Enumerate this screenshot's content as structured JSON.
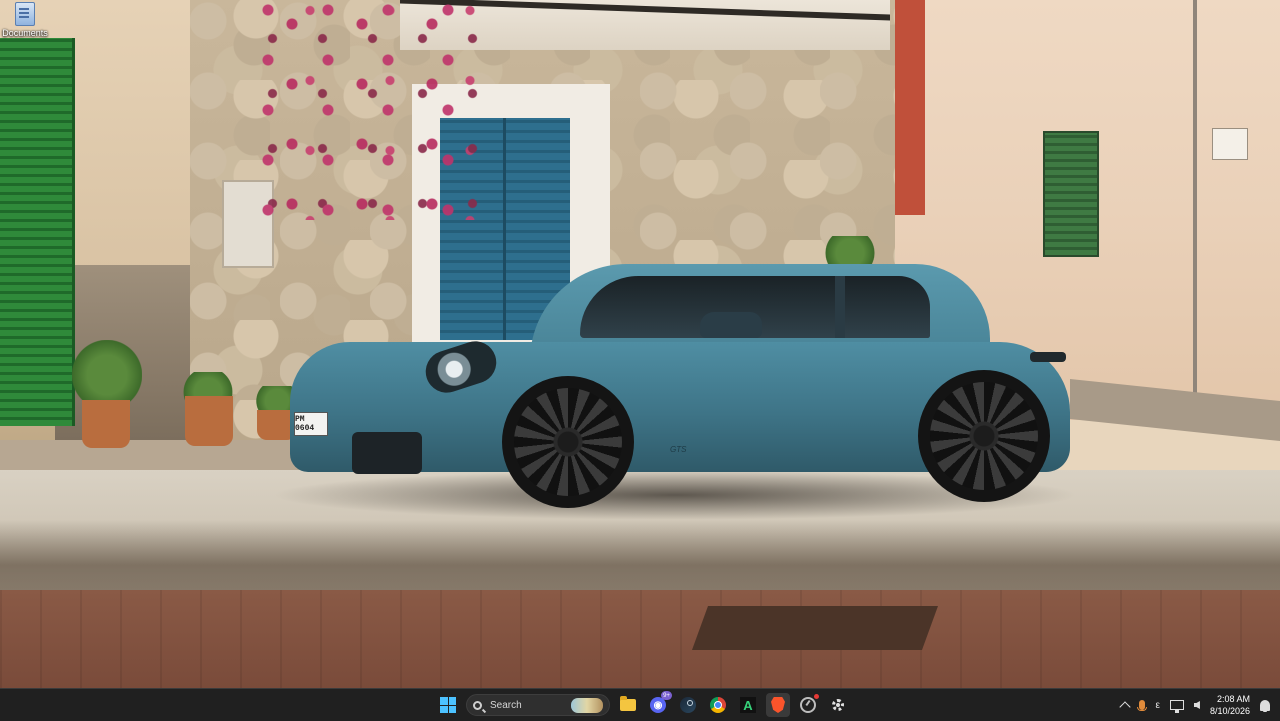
{
  "desktop": {
    "icons": [
      {
        "label": "Documents",
        "icon": "documents-icon"
      }
    ],
    "wallpaper": {
      "car_plate": "PM 0604",
      "car_badge": "GTS"
    }
  },
  "taskbar": {
    "search_placeholder": "Search",
    "apps": [
      {
        "name": "file-explorer",
        "icon": "folder-icon"
      },
      {
        "name": "discord",
        "icon": "discord-icon",
        "badge": "9+"
      },
      {
        "name": "steam",
        "icon": "steam-icon"
      },
      {
        "name": "chrome",
        "icon": "chrome-icon"
      },
      {
        "name": "vectorworks",
        "icon": "vectorworks-icon",
        "glyph": "A"
      },
      {
        "name": "brave",
        "icon": "brave-icon"
      },
      {
        "name": "monitor-app",
        "icon": "monitor-icon"
      },
      {
        "name": "settings-app",
        "icon": "gear-icon"
      }
    ],
    "tray": {
      "ime_indicator": "ε",
      "time": "2:08 AM",
      "date": "8/10/2026"
    }
  },
  "colors": {
    "accent": "#4cc2ff",
    "taskbar_bg": "#202020"
  }
}
